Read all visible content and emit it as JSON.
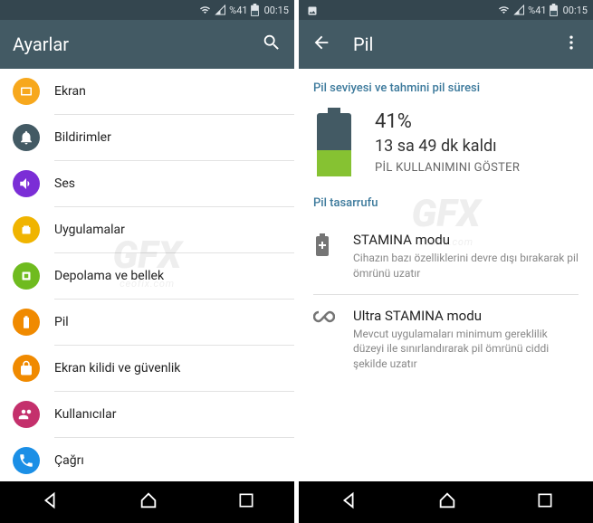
{
  "status": {
    "battery_pct": "%41",
    "time": "00:15"
  },
  "left": {
    "title": "Ayarlar",
    "items": [
      {
        "label": "Ekran",
        "bg": "#f7a81d",
        "glyph": "display"
      },
      {
        "label": "Bildirimler",
        "bg": "#435a64",
        "glyph": "bell"
      },
      {
        "label": "Ses",
        "bg": "#7b2ed6",
        "glyph": "speaker"
      },
      {
        "label": "Uygulamalar",
        "bg": "#f0b400",
        "glyph": "apps"
      },
      {
        "label": "Depolama ve bellek",
        "bg": "#6fbb1f",
        "glyph": "chip"
      },
      {
        "label": "Pil",
        "bg": "#f08a00",
        "glyph": "battery"
      },
      {
        "label": "Ekran kilidi ve güvenlik",
        "bg": "#f08a00",
        "glyph": "lock"
      },
      {
        "label": "Kullanıcılar",
        "bg": "#c4306c",
        "glyph": "users"
      },
      {
        "label": "Çağrı",
        "bg": "#1b8fe6",
        "glyph": "phone"
      }
    ]
  },
  "right": {
    "title": "Pil",
    "section_level": "Pil seviyesi ve tahmini pil süresi",
    "pct": "41%",
    "time_remaining": "13 sa  49 dk kaldı",
    "usage_link": "PİL KULLANIMINI GÖSTER",
    "section_saver": "Pil tasarrufu",
    "modes": [
      {
        "title": "STAMINA modu",
        "desc": "Cihazın bazı özelliklerini devre dışı bırakarak pil ömrünü uzatır",
        "icon": "battery-plus"
      },
      {
        "title": "Ultra STAMINA modu",
        "desc": "Mevcut uygulamaları minimum gereklilik düzeyi ile sınırlandırarak pil ömrünü ciddi şekilde uzatır",
        "icon": "infinity"
      }
    ]
  },
  "watermark": {
    "logo": "GFX",
    "url": "ceofix.com"
  }
}
